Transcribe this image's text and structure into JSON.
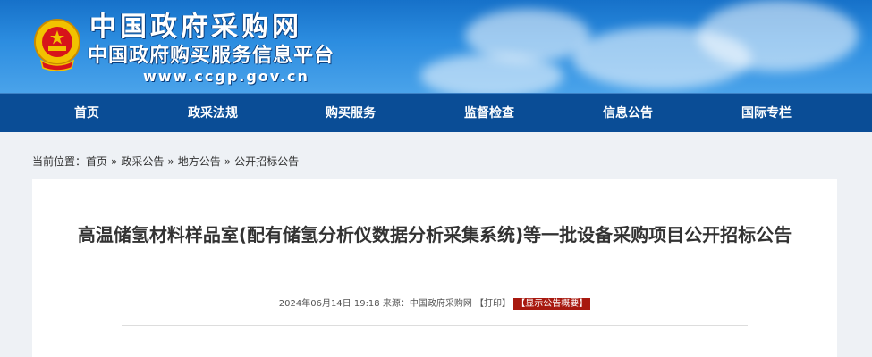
{
  "header": {
    "site_name": "中国政府采购网",
    "site_subtitle": "中国政府购买服务信息平台",
    "site_url": "www.ccgp.gov.cn",
    "emblem_icon": "national-emblem-icon",
    "colors": {
      "banner": "#2c8de0",
      "nav": "#0a4d96"
    }
  },
  "nav": {
    "items": [
      {
        "label": "首页"
      },
      {
        "label": "政采法规"
      },
      {
        "label": "购买服务"
      },
      {
        "label": "监督检查"
      },
      {
        "label": "信息公告"
      },
      {
        "label": "国际专栏"
      }
    ]
  },
  "breadcrumb": {
    "prefix": "当前位置：",
    "items": [
      "首页",
      "政采公告",
      "地方公告",
      "公开招标公告"
    ],
    "separator": "»"
  },
  "article": {
    "title": "高温储氢材料样品室(配有储氢分析仪数据分析采集系统)等一批设备采购项目公开招标公告",
    "datetime": "2024年06月14日 19:18",
    "source_label": "来源：",
    "source": "中国政府采购网",
    "print_label": "【打印】",
    "summary_label": "【显示公告概要】",
    "summary_color": "#a8190f"
  }
}
